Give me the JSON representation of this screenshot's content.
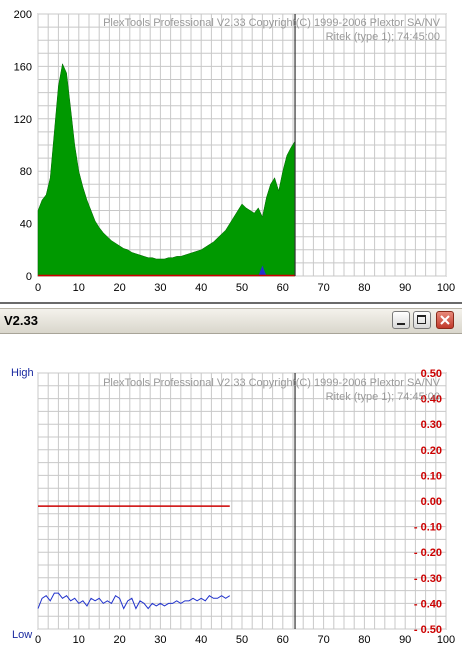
{
  "top_panel": {
    "watermark_line1": "PlexTools Professional V2.33 Copyright(C) 1999-2006 Plextor SA/NV",
    "watermark_line2": "Ritek (type 1); 74:45:00"
  },
  "window": {
    "title": "V2.33",
    "minimize_icon": "minimize-icon",
    "maximize_icon": "maximize-icon",
    "close_icon": "close-icon"
  },
  "bottom_panel": {
    "watermark_line1": "PlexTools Professional V2.33 Copyright(C) 1999-2006 Plextor SA/NV",
    "watermark_line2": "Ritek (type 1); 74:45:00",
    "left_high": "High",
    "left_low": "Low"
  },
  "colors": {
    "fill_green": "#009900",
    "jitter_blue": "#2233cc",
    "beta_red": "#cc0000",
    "grid": "#c8c8c8",
    "marker": "#333333"
  },
  "chart_data": [
    {
      "type": "area",
      "x_ticks": [
        "0",
        "10",
        "20",
        "30",
        "40",
        "50",
        "60",
        "70",
        "80",
        "90",
        "100"
      ],
      "y_ticks": [
        "0",
        "40",
        "80",
        "120",
        "160",
        "200"
      ],
      "xlim": [
        0,
        100
      ],
      "ylim": [
        0,
        200
      ],
      "grid": true,
      "marker_x": 63,
      "series": [
        {
          "color": "#009900",
          "x": [
            0,
            1,
            2,
            3,
            4,
            5,
            6,
            7,
            8,
            9,
            10,
            11,
            12,
            13,
            14,
            15,
            16,
            17,
            18,
            19,
            20,
            21,
            22,
            23,
            24,
            25,
            26,
            27,
            28,
            29,
            30,
            31,
            32,
            33,
            34,
            35,
            36,
            37,
            38,
            39,
            40,
            41,
            42,
            43,
            44,
            45,
            46,
            47,
            48,
            49,
            50,
            51,
            52,
            53,
            54,
            55,
            56,
            57,
            58,
            59,
            60,
            61,
            62,
            63
          ],
          "values": [
            50,
            58,
            62,
            75,
            110,
            145,
            162,
            155,
            128,
            100,
            80,
            68,
            58,
            50,
            42,
            37,
            33,
            30,
            27,
            25,
            23,
            21,
            20,
            18,
            17,
            16,
            15,
            14,
            14,
            13,
            13,
            13,
            14,
            14,
            15,
            15,
            16,
            17,
            18,
            19,
            20,
            22,
            24,
            26,
            29,
            32,
            35,
            40,
            45,
            50,
            55,
            52,
            50,
            48,
            52,
            45,
            60,
            70,
            75,
            65,
            80,
            92,
            98,
            103
          ]
        },
        {
          "color": "#2233cc",
          "x": [
            54,
            55,
            56
          ],
          "values": [
            0,
            8,
            0
          ]
        }
      ]
    },
    {
      "type": "line",
      "x_ticks": [
        "0",
        "10",
        "20",
        "30",
        "40",
        "50",
        "60",
        "70",
        "80",
        "90",
        "100"
      ],
      "y_ticks_right": [
        "0.50",
        "0.40",
        "0.30",
        "0.20",
        "0.10",
        "0.00",
        "- 0.10",
        "- 0.20",
        "- 0.30",
        "- 0.40",
        "- 0.50"
      ],
      "xlim": [
        0,
        100
      ],
      "ylim": [
        -0.5,
        0.5
      ],
      "grid": true,
      "marker_x": 63,
      "series": [
        {
          "color": "#cc0000",
          "x": [
            0,
            47
          ],
          "values": [
            -0.02,
            -0.02
          ]
        },
        {
          "color": "#2233cc",
          "x": [
            0,
            1,
            2,
            3,
            4,
            5,
            6,
            7,
            8,
            9,
            10,
            11,
            12,
            13,
            14,
            15,
            16,
            17,
            18,
            19,
            20,
            21,
            22,
            23,
            24,
            25,
            26,
            27,
            28,
            29,
            30,
            31,
            32,
            33,
            34,
            35,
            36,
            37,
            38,
            39,
            40,
            41,
            42,
            43,
            44,
            45,
            46,
            47
          ],
          "values": [
            -0.42,
            -0.38,
            -0.37,
            -0.39,
            -0.36,
            -0.36,
            -0.38,
            -0.37,
            -0.39,
            -0.38,
            -0.4,
            -0.39,
            -0.41,
            -0.38,
            -0.39,
            -0.38,
            -0.4,
            -0.39,
            -0.4,
            -0.37,
            -0.38,
            -0.42,
            -0.39,
            -0.38,
            -0.42,
            -0.39,
            -0.4,
            -0.42,
            -0.4,
            -0.41,
            -0.4,
            -0.41,
            -0.4,
            -0.4,
            -0.39,
            -0.4,
            -0.39,
            -0.39,
            -0.38,
            -0.39,
            -0.38,
            -0.39,
            -0.37,
            -0.38,
            -0.38,
            -0.37,
            -0.38,
            -0.37
          ]
        }
      ]
    }
  ]
}
